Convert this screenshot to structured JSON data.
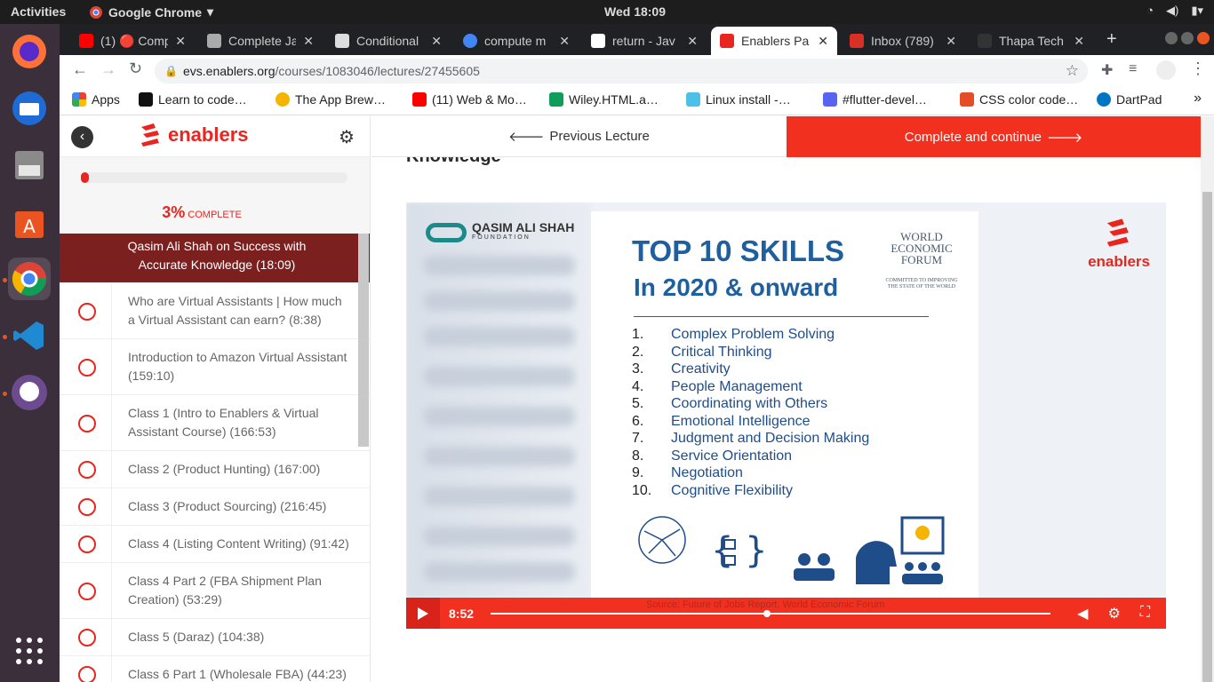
{
  "system": {
    "activities": "Activities",
    "app_name": "Google Chrome",
    "clock": "Wed 18:09"
  },
  "tabs": [
    {
      "title": "(1) 🔴 Comp",
      "color": "#ff0000"
    },
    {
      "title": "Complete Ja",
      "color": "#aaaaaa"
    },
    {
      "title": "Conditional",
      "color": "#dddddd"
    },
    {
      "title": "compute m",
      "color": "#4285f4"
    },
    {
      "title": "return - Jav",
      "color": "#ffffff"
    },
    {
      "title": "Enablers Pa",
      "color": "#e8261f"
    },
    {
      "title": "Inbox (789)",
      "color": "#d93025"
    },
    {
      "title": "Thapa Tech",
      "color": "#333333"
    }
  ],
  "url": {
    "host": "evs.enablers.org",
    "path": "/courses/1083046/lectures/27455605"
  },
  "bookmarks": [
    {
      "label": "Apps",
      "color": "#4285f4"
    },
    {
      "label": "Learn to code…",
      "color": "#111111"
    },
    {
      "label": "The App Brew…",
      "color": "#f4b400"
    },
    {
      "label": "(11) Web & Mo…",
      "color": "#ff0000"
    },
    {
      "label": "Wiley.HTML.a…",
      "color": "#0f9d58"
    },
    {
      "label": "Linux install -…",
      "color": "#4dc0e8"
    },
    {
      "label": "#flutter-devel…",
      "color": "#5865f2"
    },
    {
      "label": "CSS color code…",
      "color": "#e44d26"
    },
    {
      "label": "DartPad",
      "color": "#0175c2"
    }
  ],
  "course": {
    "progress_percent": 3,
    "progress_value": "3%",
    "progress_label": "COMPLETE",
    "current_lecture": "Qasim Ali Shah on Success with Accurate Knowledge (18:09)",
    "lectures": [
      "Who are Virtual Assistants | How much a Virtual Assistant can earn? (8:38)",
      "Introduction to Amazon Virtual Assistant (159:10)",
      "Class 1 (Intro to Enablers & Virtual Assistant Course) (166:53)",
      "Class 2 (Product Hunting) (167:00)",
      "Class 3 (Product Sourcing) (216:45)",
      "Class 4 (Listing Content Writing) (91:42)",
      "Class 4 Part 2 (FBA Shipment Plan Creation) (53:29)",
      "Class 5 (Daraz) (104:38)",
      "Class 6 Part 1 (Wholesale FBA) (44:23)"
    ]
  },
  "nav": {
    "prev": "Previous Lecture",
    "next": "Complete and continue"
  },
  "lecture_heading": "Knowledge",
  "video": {
    "slide_title_1": "TOP 10 SKILLS",
    "slide_title_2": "In 2020 & onward",
    "wef_lines": [
      "WORLD",
      "ECONOMIC",
      "FORUM"
    ],
    "wef_tagline": "COMMITTED TO IMPROVING THE STATE OF THE WORLD",
    "qas_name": "QASIM ALI SHAH",
    "qas_sub": "FOUNDATION",
    "brand": "enablers",
    "skills": [
      {
        "n": "1.",
        "t": "Complex Problem Solving"
      },
      {
        "n": "2.",
        "t": "Critical Thinking"
      },
      {
        "n": "3.",
        "t": "Creativity"
      },
      {
        "n": "4.",
        "t": "People Management"
      },
      {
        "n": "5.",
        "t": "Coordinating with Others"
      },
      {
        "n": "6.",
        "t": "Emotional Intelligence"
      },
      {
        "n": "7.",
        "t": "Judgment and Decision Making"
      },
      {
        "n": "8.",
        "t": "Service Orientation"
      },
      {
        "n": "9.",
        "t": "Negotiation"
      },
      {
        "n": "10.",
        "t": "Cognitive Flexibility"
      }
    ],
    "caption": "Source: Future of Jobs Report, World Economic Forum",
    "time": "8:52",
    "played_fraction": 0.487
  },
  "colors": {
    "brand": "#f2301f",
    "current": "#7b1f1f"
  }
}
